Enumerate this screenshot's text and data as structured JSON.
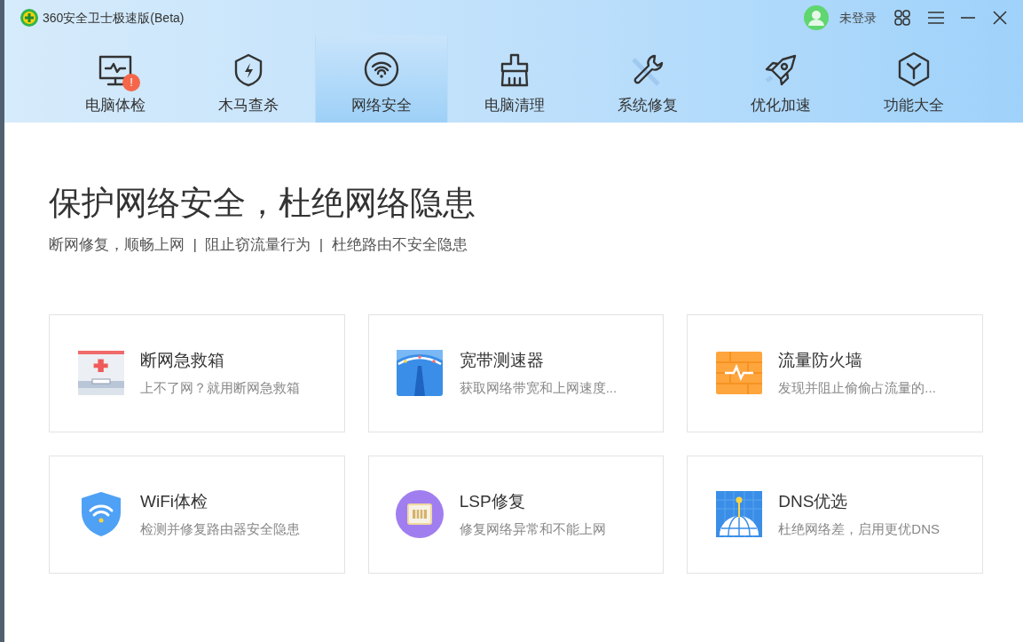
{
  "window": {
    "title": "360安全卫士极速版(Beta)",
    "user": "未登录"
  },
  "tabs": [
    {
      "label": "电脑体检",
      "selected": false,
      "alert": "!"
    },
    {
      "label": "木马查杀",
      "selected": false
    },
    {
      "label": "网络安全",
      "selected": true
    },
    {
      "label": "电脑清理",
      "selected": false
    },
    {
      "label": "系统修复",
      "selected": false
    },
    {
      "label": "优化加速",
      "selected": false
    },
    {
      "label": "功能大全",
      "selected": false
    }
  ],
  "headline": "保护网络安全，杜绝网络隐患",
  "subtitle": "断网修复，顺畅上网  |  阻止窃流量行为  |  杜绝路由不安全隐患",
  "tools": [
    {
      "name": "断网急救箱",
      "description": "上不了网？就用断网急救箱"
    },
    {
      "name": "宽带测速器",
      "description": "获取网络带宽和上网速度..."
    },
    {
      "name": "流量防火墙",
      "description": "发现并阻止偷偷占流量的..."
    },
    {
      "name": "WiFi体检",
      "description": "检测并修复路由器安全隐患"
    },
    {
      "name": "LSP修复",
      "description": "修复网络异常和不能上网"
    },
    {
      "name": "DNS优选",
      "description": "杜绝网络差，启用更优DNS"
    }
  ]
}
